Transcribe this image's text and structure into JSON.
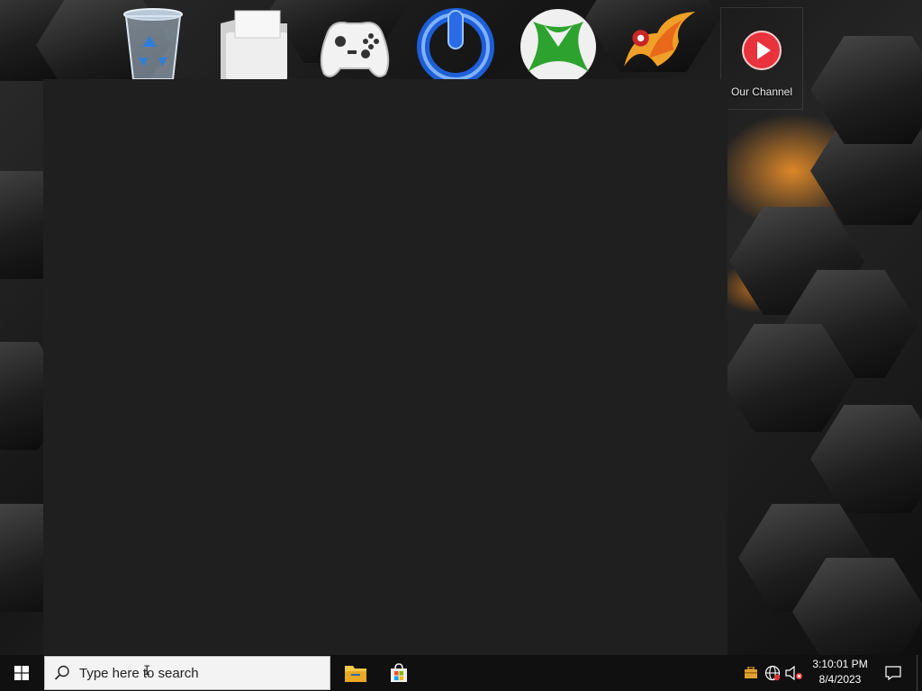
{
  "desktop": {
    "shortcut_label": "Our Channel",
    "icons": [
      {
        "name": "recycle-bin-icon"
      },
      {
        "name": "folder-icon"
      },
      {
        "name": "gamepad-icon"
      },
      {
        "name": "power-icon"
      },
      {
        "name": "xbox-icon"
      },
      {
        "name": "phoenix-icon"
      },
      {
        "name": "play-icon"
      }
    ]
  },
  "taskbar": {
    "search_placeholder": "Type here to search",
    "time": "3:10:01 PM",
    "date": "8/4/2023",
    "pinned": [
      "file-explorer-icon",
      "microsoft-store-icon"
    ],
    "tray": [
      "briefcase-icon",
      "network-icon",
      "volume-muted-icon"
    ]
  },
  "colors": {
    "taskbar_bg": "#101010",
    "window_bg": "#1f1f1f",
    "accent_orange": "#e68c28",
    "play_red": "#e8323c"
  }
}
